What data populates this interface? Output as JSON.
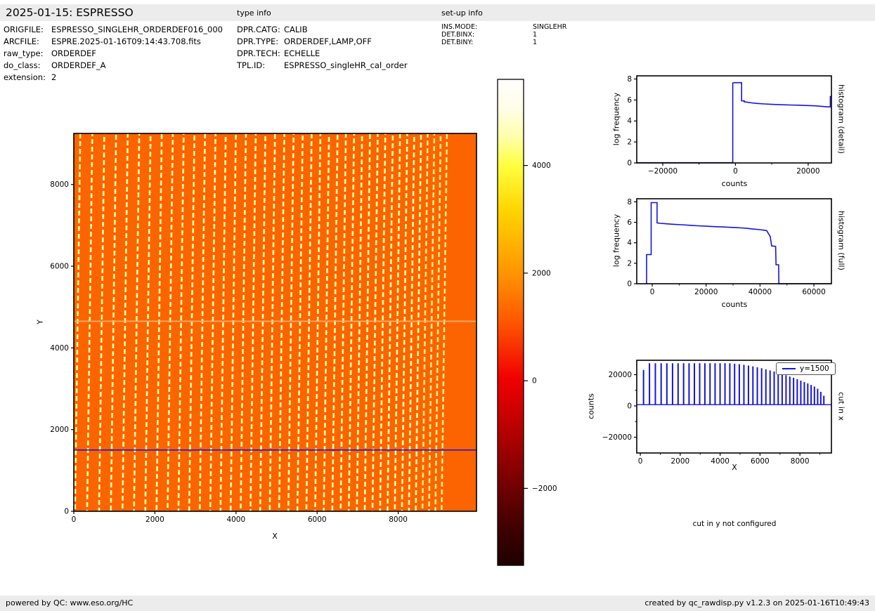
{
  "header": {
    "title": "2025-01-15: ESPRESSO",
    "type_info_label": "type info",
    "setup_info_label": "set-up info"
  },
  "metadata": {
    "file_info": [
      {
        "label": "ORIGFILE:",
        "value": "ESPRESSO_SINGLEHR_ORDERDEF016_000"
      },
      {
        "label": "ARCFILE:",
        "value": "ESPRE.2025-01-16T09:14:43.708.fits"
      },
      {
        "label": "raw_type:",
        "value": "ORDERDEF"
      },
      {
        "label": "do_class:",
        "value": "ORDERDEF_A"
      },
      {
        "label": "extension:",
        "value": "2"
      }
    ],
    "type_info": [
      {
        "label": "DPR.CATG:",
        "value": "CALIB"
      },
      {
        "label": "DPR.TYPE:",
        "value": "ORDERDEF,LAMP,OFF"
      },
      {
        "label": "DPR.TECH:",
        "value": "ECHELLE"
      },
      {
        "label": "TPL.ID:",
        "value": "ESPRESSO_singleHR_cal_order"
      }
    ],
    "setup_info": [
      {
        "label": "INS.MODE:",
        "value": "SINGLEHR"
      },
      {
        "label": "DET.BINX:",
        "value": "1"
      },
      {
        "label": "DET.BINY:",
        "value": "1"
      }
    ]
  },
  "messages": {
    "cut_in_y": "cut in y not configured"
  },
  "footer": {
    "left": "powered by QC: www.eso.org/HC",
    "right": "created by qc_rawdisp.py v1.2.3 on 2025-01-16T10:49:43"
  },
  "chart_data": [
    {
      "id": "raw_image",
      "type": "heatmap",
      "xlabel": "X",
      "ylabel": "Y",
      "xlim": [
        0,
        9930
      ],
      "ylim": [
        0,
        9250
      ],
      "x_ticks": [
        0,
        2000,
        4000,
        6000,
        8000
      ],
      "y_ticks": [
        0,
        2000,
        4000,
        6000,
        8000
      ],
      "background_color": "#fb6400",
      "stripe_core_color": "#ffffff",
      "stripe_fringe_color": "#ffd900",
      "order_positions_x": [
        160,
        458,
        753,
        1043,
        1330,
        1614,
        1893,
        2169,
        2442,
        2710,
        2975,
        3236,
        3494,
        3747,
        3997,
        4244,
        4486,
        4725,
        4961,
        5192,
        5420,
        5644,
        5865,
        6081,
        6294,
        6504,
        6709,
        6911,
        7110,
        7304,
        7495,
        7682,
        7866,
        8045,
        8221,
        8394,
        8562,
        8727,
        8889,
        9046,
        9200
      ],
      "order_tilt_dx": -130,
      "detector_gap_y": 4650,
      "cut_line_y": 1500,
      "cut_line_color": "#1212dd",
      "description": "ESPRESSO raw echelle order-definition frame: ~41 dashed bright order traces on uniform orange background, horizontal detector gap near y=4650, blue cut line at y=1500"
    },
    {
      "id": "colorbar",
      "type": "colorbar",
      "colormap": "hot",
      "vmin": -3430,
      "vmax": 5600,
      "ticks": [
        4000,
        2000,
        0,
        -2000
      ],
      "gradient_stops": [
        [
          0,
          "#ffffff"
        ],
        [
          0.06,
          "#fffde8"
        ],
        [
          0.12,
          "#ffffa8"
        ],
        [
          0.178,
          "#ffff3e"
        ],
        [
          0.27,
          "#ffd400"
        ],
        [
          0.4,
          "#ff9400"
        ],
        [
          0.5,
          "#ff5600"
        ],
        [
          0.615,
          "#f10000"
        ],
        [
          0.7,
          "#c30000"
        ],
        [
          0.842,
          "#6f0000"
        ],
        [
          0.93,
          "#3c0000"
        ],
        [
          1,
          "#1f0000"
        ]
      ]
    },
    {
      "id": "histogram_detail",
      "type": "line",
      "title_right": "histogram (detail)",
      "xlabel": "counts",
      "ylabel": "log frequency",
      "xlim": [
        -27150,
        26400
      ],
      "ylim": [
        0,
        8.3
      ],
      "x_ticks": [
        -20000,
        0,
        20000
      ],
      "x_minor_ticks": [
        -10000,
        10000
      ],
      "y_ticks": [
        0,
        2,
        4,
        6,
        8
      ],
      "line_color": "#1414dd",
      "points": [
        [
          -27100,
          0.02
        ],
        [
          -750,
          0.02
        ],
        [
          -750,
          7.62
        ],
        [
          -350,
          7.65
        ],
        [
          1700,
          7.65
        ],
        [
          1700,
          5.92
        ],
        [
          2400,
          5.92
        ],
        [
          2400,
          5.83
        ],
        [
          3300,
          5.78
        ],
        [
          4500,
          5.72
        ],
        [
          6000,
          5.67
        ],
        [
          8000,
          5.62
        ],
        [
          10000,
          5.58
        ],
        [
          12500,
          5.55
        ],
        [
          15000,
          5.52
        ],
        [
          17500,
          5.5
        ],
        [
          20000,
          5.47
        ],
        [
          22000,
          5.44
        ],
        [
          24000,
          5.38
        ],
        [
          25500,
          5.34
        ],
        [
          26100,
          5.34
        ],
        [
          26100,
          6.33
        ],
        [
          26400,
          6.33
        ]
      ]
    },
    {
      "id": "histogram_full",
      "type": "line",
      "title_right": "histogram (full)",
      "xlabel": "counts",
      "ylabel": "log frequency",
      "xlim": [
        -5750,
        66500
      ],
      "ylim": [
        0,
        8.3
      ],
      "x_ticks": [
        0,
        20000,
        40000,
        60000
      ],
      "x_minor_ticks": [
        10000,
        30000,
        50000
      ],
      "y_ticks": [
        0,
        2,
        4,
        6,
        8
      ],
      "line_color": "#1414dd",
      "points": [
        [
          -2100,
          0
        ],
        [
          -2100,
          2.85
        ],
        [
          -400,
          2.85
        ],
        [
          -400,
          7.92
        ],
        [
          1800,
          7.92
        ],
        [
          1800,
          5.95
        ],
        [
          3000,
          5.9
        ],
        [
          5000,
          5.86
        ],
        [
          8000,
          5.8
        ],
        [
          11000,
          5.76
        ],
        [
          14000,
          5.71
        ],
        [
          17000,
          5.66
        ],
        [
          20000,
          5.62
        ],
        [
          23000,
          5.58
        ],
        [
          26000,
          5.55
        ],
        [
          29000,
          5.51
        ],
        [
          31000,
          5.48
        ],
        [
          33000,
          5.45
        ],
        [
          35000,
          5.41
        ],
        [
          37000,
          5.36
        ],
        [
          38500,
          5.32
        ],
        [
          40000,
          5.28
        ],
        [
          41500,
          5.23
        ],
        [
          42500,
          5.18
        ],
        [
          43000,
          4.95
        ],
        [
          43800,
          4.6
        ],
        [
          44300,
          3.7
        ],
        [
          45800,
          3.65
        ],
        [
          45950,
          1.85
        ],
        [
          46900,
          1.85
        ],
        [
          47000,
          0
        ],
        [
          66400,
          0
        ]
      ]
    },
    {
      "id": "cut_in_x",
      "type": "spikes",
      "title_right": "cut in x",
      "xlabel": "X",
      "ylabel": "counts",
      "xlim": [
        -180,
        9580
      ],
      "ylim": [
        -30100,
        29200
      ],
      "x_ticks": [
        0,
        2000,
        4000,
        6000,
        8000
      ],
      "x_minor_ticks": [
        1000,
        3000,
        5000,
        7000,
        9000
      ],
      "y_ticks": [
        20000,
        0,
        -20000
      ],
      "y_minor_ticks": [
        10000,
        -10000
      ],
      "legend_label": "y=1500",
      "line_color": "#1414dd",
      "baseline": 800,
      "spike_x": [
        160,
        458,
        753,
        1043,
        1330,
        1614,
        1893,
        2169,
        2442,
        2710,
        2975,
        3236,
        3494,
        3747,
        3997,
        4244,
        4486,
        4725,
        4961,
        5192,
        5420,
        5644,
        5865,
        6081,
        6294,
        6504,
        6709,
        6911,
        7110,
        7304,
        7495,
        7682,
        7866,
        8045,
        8221,
        8394,
        8562,
        8727,
        8889,
        9046,
        9200
      ],
      "spike_heights": [
        23000,
        27300,
        27300,
        27300,
        27300,
        27300,
        27300,
        27300,
        27300,
        27300,
        27300,
        27300,
        27300,
        27300,
        27300,
        27300,
        27300,
        27000,
        26700,
        26300,
        25800,
        25300,
        24700,
        24100,
        23400,
        22700,
        22000,
        21200,
        20400,
        19600,
        18800,
        18000,
        17100,
        16200,
        15300,
        14400,
        13400,
        12400,
        11000,
        9000,
        6500
      ]
    }
  ]
}
